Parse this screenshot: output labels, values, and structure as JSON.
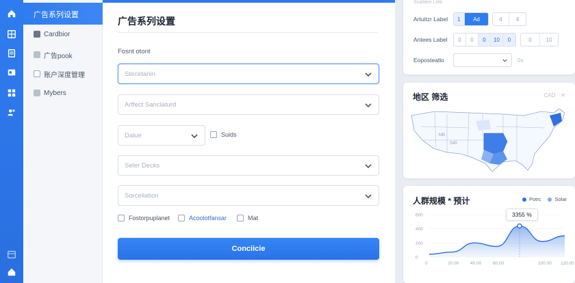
{
  "sidebar": {
    "items": [
      {
        "label": "广告系列设置"
      },
      {
        "label": "Cardbior"
      },
      {
        "label": "广告pook"
      },
      {
        "label": "账户深度管理"
      },
      {
        "label": "Mybers"
      }
    ]
  },
  "form": {
    "title": "广告系列设置",
    "section_label": "Fosnt otont",
    "select1_placeholder": "Stecetanin",
    "select2_placeholder": "Arffect Sanclaturd",
    "small_select_placeholder": "Dalue",
    "inline_checkbox_label": "Suids",
    "select3_placeholder": "Seler Decks",
    "select4_placeholder": "Sorcellation",
    "checkboxes": [
      {
        "label": "Fostorpuplanet"
      },
      {
        "label": "Acoolotfansar"
      },
      {
        "label": "Mat"
      }
    ],
    "submit_label": "Conciicie"
  },
  "settings_card": {
    "caption": "Scaltitee Lleb",
    "row1": {
      "label": "Artuitzr Label",
      "segments": [
        "1",
        "Ad",
        "4",
        "4"
      ]
    },
    "row2": {
      "label": "Antees Label",
      "segments": [
        "0",
        "0",
        "0",
        "10",
        "0"
      ],
      "extra": [
        "0",
        "10"
      ]
    },
    "row3": {
      "label": "Eoposteatlo",
      "tail": "0s"
    }
  },
  "map_card": {
    "title": "地区 筛选",
    "tools": [
      "CAD",
      "✕"
    ],
    "labels": [
      "MB",
      "S40"
    ]
  },
  "chart_card": {
    "title": "人群规模 * 预计",
    "tooltip": "3355 %",
    "legend": [
      {
        "name": "Potrc",
        "color": "#2f6fe0"
      },
      {
        "name": "Solar",
        "color": "#7fa9ee"
      }
    ]
  },
  "chart_data": {
    "type": "area",
    "x": [
      0,
      20,
      40,
      60,
      80,
      100,
      120
    ],
    "xticks": [
      "0",
      "20.00",
      "40.00",
      "60.00",
      "100.00",
      "120.00"
    ],
    "yticks": [
      "0",
      "200",
      "400",
      "600"
    ],
    "ylim": [
      0,
      600
    ],
    "series": [
      {
        "name": "Potrc",
        "values": [
          40,
          70,
          200,
          150,
          440,
          220,
          300
        ]
      }
    ],
    "highlight_index": 4,
    "color": "#2f6fe0"
  }
}
